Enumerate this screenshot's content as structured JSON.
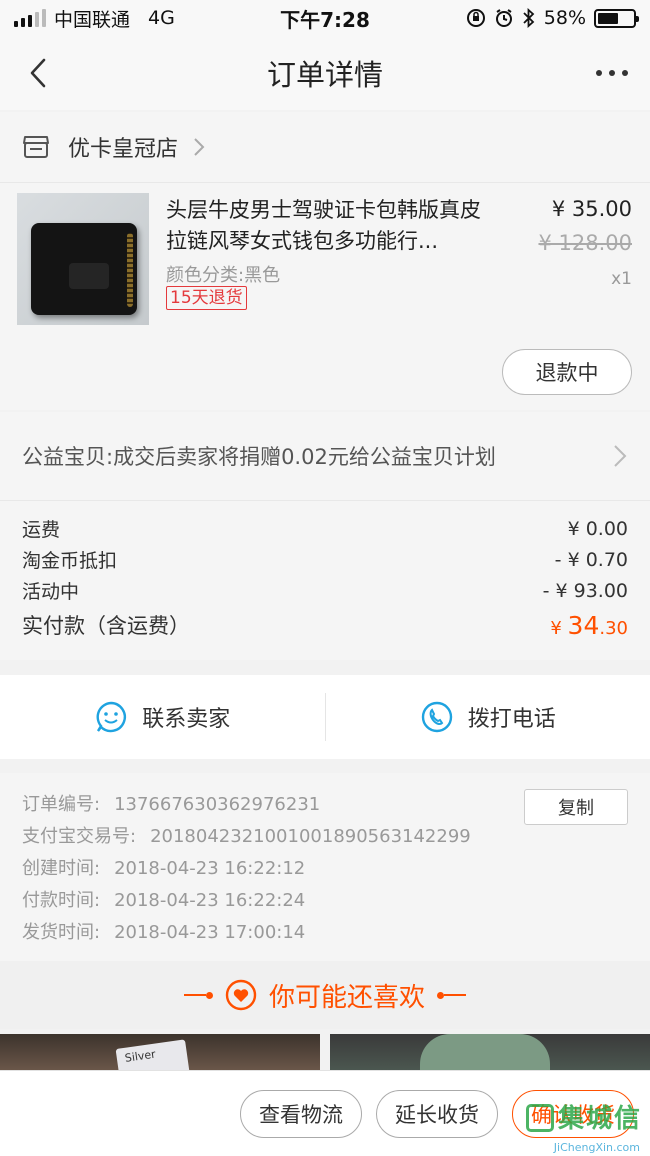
{
  "status_bar": {
    "carrier": "中国联通",
    "network": "4G",
    "time": "下午7:28",
    "battery": "58%",
    "battery_level": 0.58
  },
  "nav": {
    "title": "订单详情"
  },
  "shop": {
    "name": "优卡皇冠店"
  },
  "item": {
    "title": "头层牛皮男士驾驶证卡包韩版真皮拉链风琴女式钱包多功能行...",
    "sku": "颜色分类:黑色",
    "tag": "15天退货",
    "price_now": "¥ 35.00",
    "price_old": "¥ 128.00",
    "qty": "x1",
    "refund_label": "退款中"
  },
  "charity": {
    "text": "公益宝贝:成交后卖家将捐赠0.02元给公益宝贝计划"
  },
  "costs": {
    "rows": [
      {
        "label": "运费",
        "value": "¥ 0.00"
      },
      {
        "label": "淘金币抵扣",
        "value": "- ¥ 0.70"
      },
      {
        "label": "活动中",
        "value": "- ¥ 93.00"
      }
    ],
    "total_label": "实付款（含运费）",
    "total_currency": "¥ ",
    "total_int": "34",
    "total_dec": ".30"
  },
  "contact": {
    "seller_label": "联系卖家",
    "phone_label": "拨打电话"
  },
  "order_info": {
    "copy_label": "复制",
    "rows": [
      {
        "label": "订单编号:",
        "value": "137667630362976231"
      },
      {
        "label": "支付宝交易号:",
        "value": "2018042321001001890563142299"
      },
      {
        "label": "创建时间:",
        "value": "2018-04-23 16:22:12"
      },
      {
        "label": "付款时间:",
        "value": "2018-04-23 16:22:24"
      },
      {
        "label": "发货时间:",
        "value": "2018-04-23 17:00:14"
      }
    ]
  },
  "recommend": {
    "title": "你可能还喜欢"
  },
  "product_card_text": "Silver",
  "bottom_bar": {
    "logistics": "查看物流",
    "extend": "延长收货",
    "confirm": "确认收货"
  },
  "watermark": {
    "cn": "集城信",
    "en": "JiChengXin.com"
  },
  "colors": {
    "accent": "#ff5000",
    "tag_red": "#e4393c",
    "contact_blue": "#1fa3e0"
  }
}
